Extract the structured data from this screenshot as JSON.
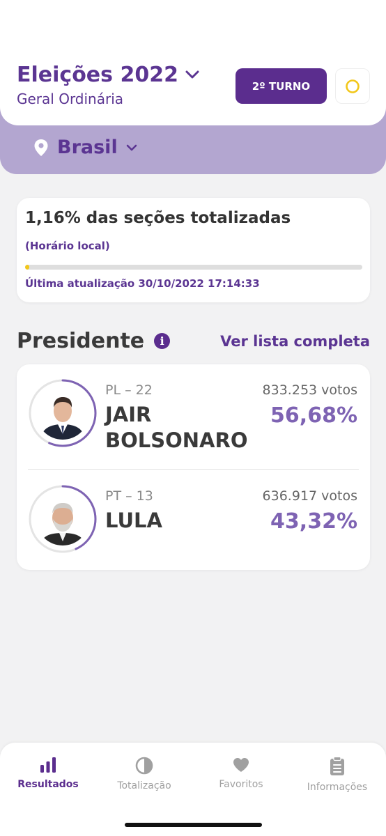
{
  "header": {
    "title": "Eleições 2022",
    "subtitle": "Geral Ordinária",
    "round_button": "2º TURNO",
    "location": "Brasil"
  },
  "progress": {
    "title": "1,16% das seções totalizadas",
    "note": "(Horário local)",
    "percent": 1.16,
    "updated": "Última atualização 30/10/2022 17:14:33"
  },
  "section": {
    "title": "Presidente",
    "see_all": "Ver lista completa"
  },
  "candidates": [
    {
      "party": "PL – 22",
      "name_line1": "JAIR",
      "name_line2": "BOLSONARO",
      "votes": "833.253 votos",
      "percent": "56,68%",
      "share": 56.68
    },
    {
      "party": "PT – 13",
      "name_line1": "LULA",
      "name_line2": "",
      "votes": "636.917 votos",
      "percent": "43,32%",
      "share": 43.32
    }
  ],
  "nav": {
    "items": [
      {
        "label": "Resultados",
        "icon": "bar-chart-icon",
        "active": true
      },
      {
        "label": "Totalização",
        "icon": "pie-icon",
        "active": false
      },
      {
        "label": "Favoritos",
        "icon": "heart-icon",
        "active": false
      },
      {
        "label": "Informações",
        "icon": "clipboard-icon",
        "active": false
      }
    ]
  },
  "colors": {
    "primary": "#5b2d8e",
    "accent_light": "#b3a6d0",
    "percent": "#7e63b3",
    "progress": "#f2c71a"
  }
}
